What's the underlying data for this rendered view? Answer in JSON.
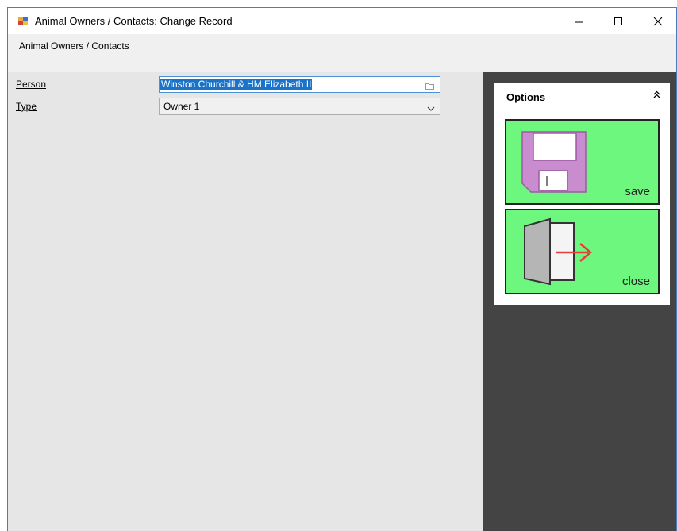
{
  "window": {
    "title": "Animal Owners / Contacts: Change Record",
    "icon": "app-window-icon"
  },
  "menubar": {
    "label": "Animal Owners / Contacts"
  },
  "form": {
    "person": {
      "label": "Person",
      "value": "Winston Churchill & HM Elizabeth II",
      "icon": "browse-folder-icon"
    },
    "type": {
      "label": "Type",
      "value": "Owner 1",
      "icon": "chevron-down-icon"
    }
  },
  "options": {
    "title": "Options",
    "collapse_icon": "double-chevron-up-icon",
    "buttons": [
      {
        "label": "save",
        "icon": "floppy-disk-icon"
      },
      {
        "label": "close",
        "icon": "exit-door-icon"
      }
    ]
  },
  "colors": {
    "tile_green": "#6ef77e",
    "side_panel": "#444444",
    "selection": "#1a73c9",
    "floppy": "#c98ccf",
    "arrow": "#e83c3c"
  }
}
